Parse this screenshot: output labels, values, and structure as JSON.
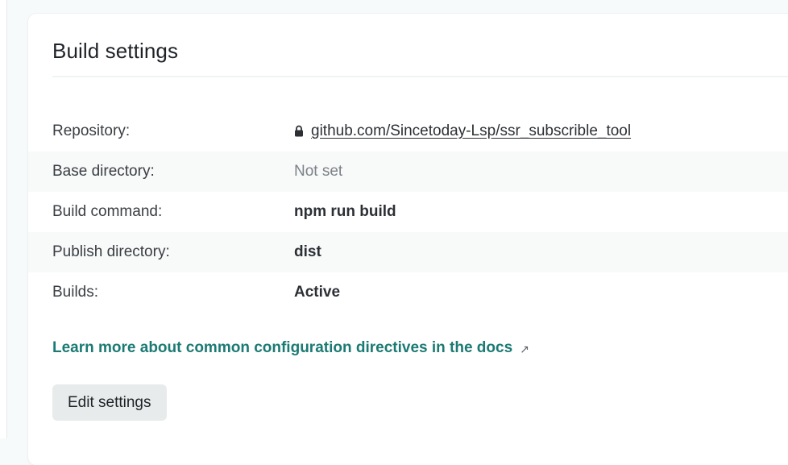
{
  "card": {
    "title": "Build settings"
  },
  "settings": [
    {
      "label": "Repository:",
      "value": "github.com/Sincetoday-Lsp/ssr_subscrible_tool",
      "locked": true
    },
    {
      "label": "Base directory:",
      "value": "Not set"
    },
    {
      "label": "Build command:",
      "value": "npm run build"
    },
    {
      "label": "Publish directory:",
      "value": "dist"
    },
    {
      "label": "Builds:",
      "value": "Active"
    }
  ],
  "docs_link": {
    "text": "Learn more about common configuration directives in the docs",
    "icon": "external-link-icon"
  },
  "actions": {
    "edit_label": "Edit settings"
  },
  "colors": {
    "link_accent": "#1b7a73",
    "muted_text": "#7c8288",
    "button_bg": "#e8ebeb"
  }
}
